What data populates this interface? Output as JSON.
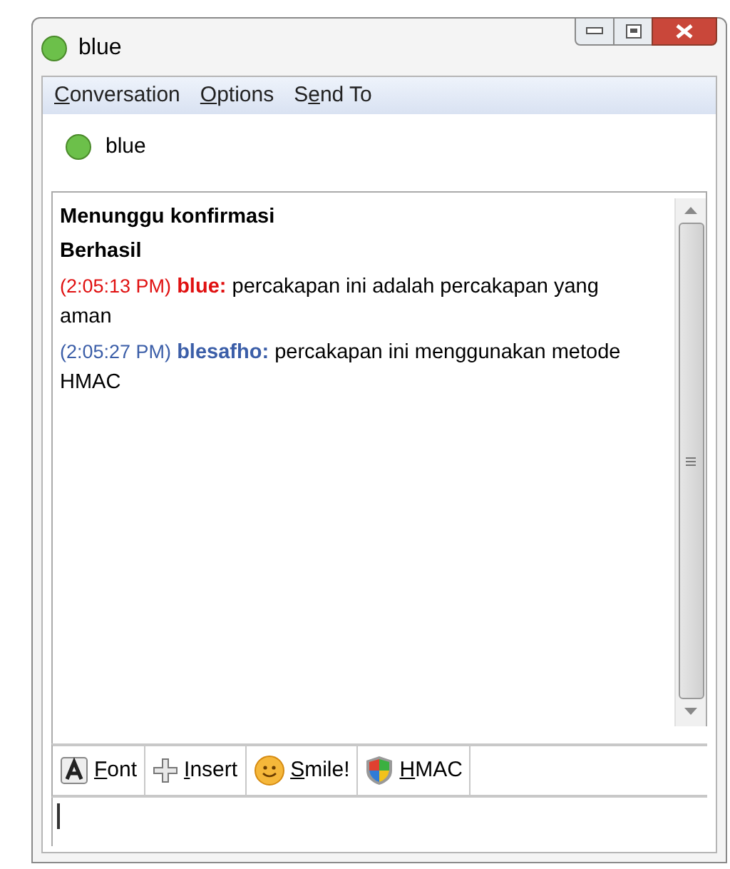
{
  "window": {
    "title": "blue"
  },
  "menu": [
    {
      "key": "C",
      "post": "onversation"
    },
    {
      "key": "O",
      "post": "ptions"
    },
    {
      "pre": "S",
      "key": "e",
      "post": "nd To"
    }
  ],
  "contact": {
    "name": "blue"
  },
  "messages": [
    {
      "kind": "status",
      "text": "Menunggu konfirmasi"
    },
    {
      "kind": "status",
      "text": "Berhasil"
    },
    {
      "kind": "message",
      "time": "(2:05:13 PM)",
      "sender": "blue:",
      "text": "percakapan ini adalah percakapan yang aman",
      "color": "#e01010"
    },
    {
      "kind": "message",
      "time": "(2:05:27 PM)",
      "sender": "blesafho:",
      "text": "percakapan ini menggunakan metode HMAC",
      "color": "#3b5ea8"
    }
  ],
  "toolbar": [
    {
      "kind": "font",
      "key": "F",
      "post": "ont"
    },
    {
      "kind": "insert",
      "key": "I",
      "post": "nsert"
    },
    {
      "kind": "smile",
      "key": "S",
      "post": "mile!"
    },
    {
      "kind": "shield",
      "key": "H",
      "post": "MAC"
    }
  ]
}
